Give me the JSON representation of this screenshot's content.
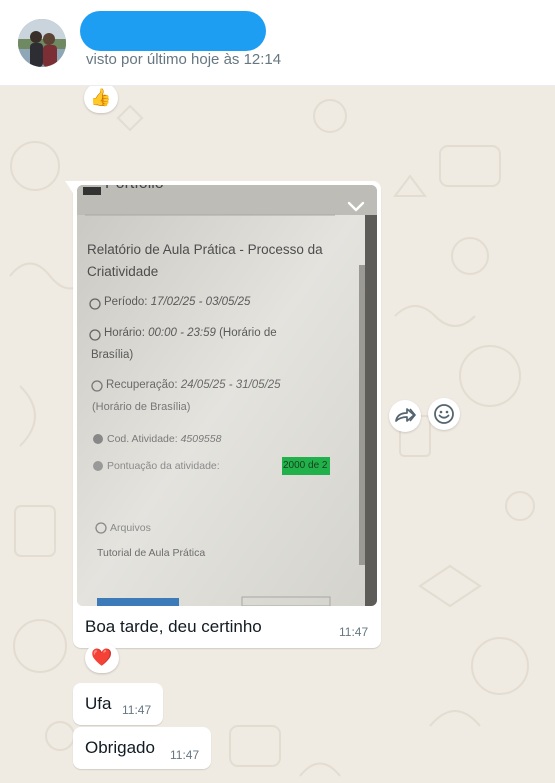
{
  "header": {
    "last_seen": "visto por último hoje às 12:14"
  },
  "reactions": {
    "top": "👍",
    "heart": "❤️"
  },
  "photo": {
    "header_fragment": "Portfólio",
    "title_line1": "Relatório de Aula Prática - Processo da",
    "title_line2": "Criatividade",
    "periodo_label": "Período:",
    "periodo_value": "17/02/25 - 03/05/25",
    "horario_label": "Horário:",
    "horario_value": "00:00 - 23:59",
    "horario_suffix": "(Horário de",
    "horario_line2": "Brasília)",
    "recuperacao_label": "Recuperação:",
    "recuperacao_value": "24/05/25 - 31/05/25",
    "recuperacao_line2": "(Horário de Brasília)",
    "cod_label": "Cod. Atividade:",
    "cod_value": "4509558",
    "pontuacao_label": "Pontuação da atividade:",
    "pontuacao_value": "2000 de 2",
    "arquivos_label": "Arquivos",
    "tutorial_label": "Tutorial de Aula Prática"
  },
  "messages": [
    {
      "text": "Boa tarde, deu certinho",
      "time": "11:47"
    },
    {
      "text": "Ufa",
      "time": "11:47"
    },
    {
      "text": "Obrigado",
      "time": "11:47"
    }
  ],
  "icons": {
    "forward": "forward-icon",
    "emoji": "emoji-icon",
    "chevron": "chevron-down-icon"
  },
  "colors": {
    "redaction": "#1e9ef2",
    "chat_background": "#efeae2",
    "bubble": "#ffffff",
    "highlight_green": "#21b14b"
  }
}
